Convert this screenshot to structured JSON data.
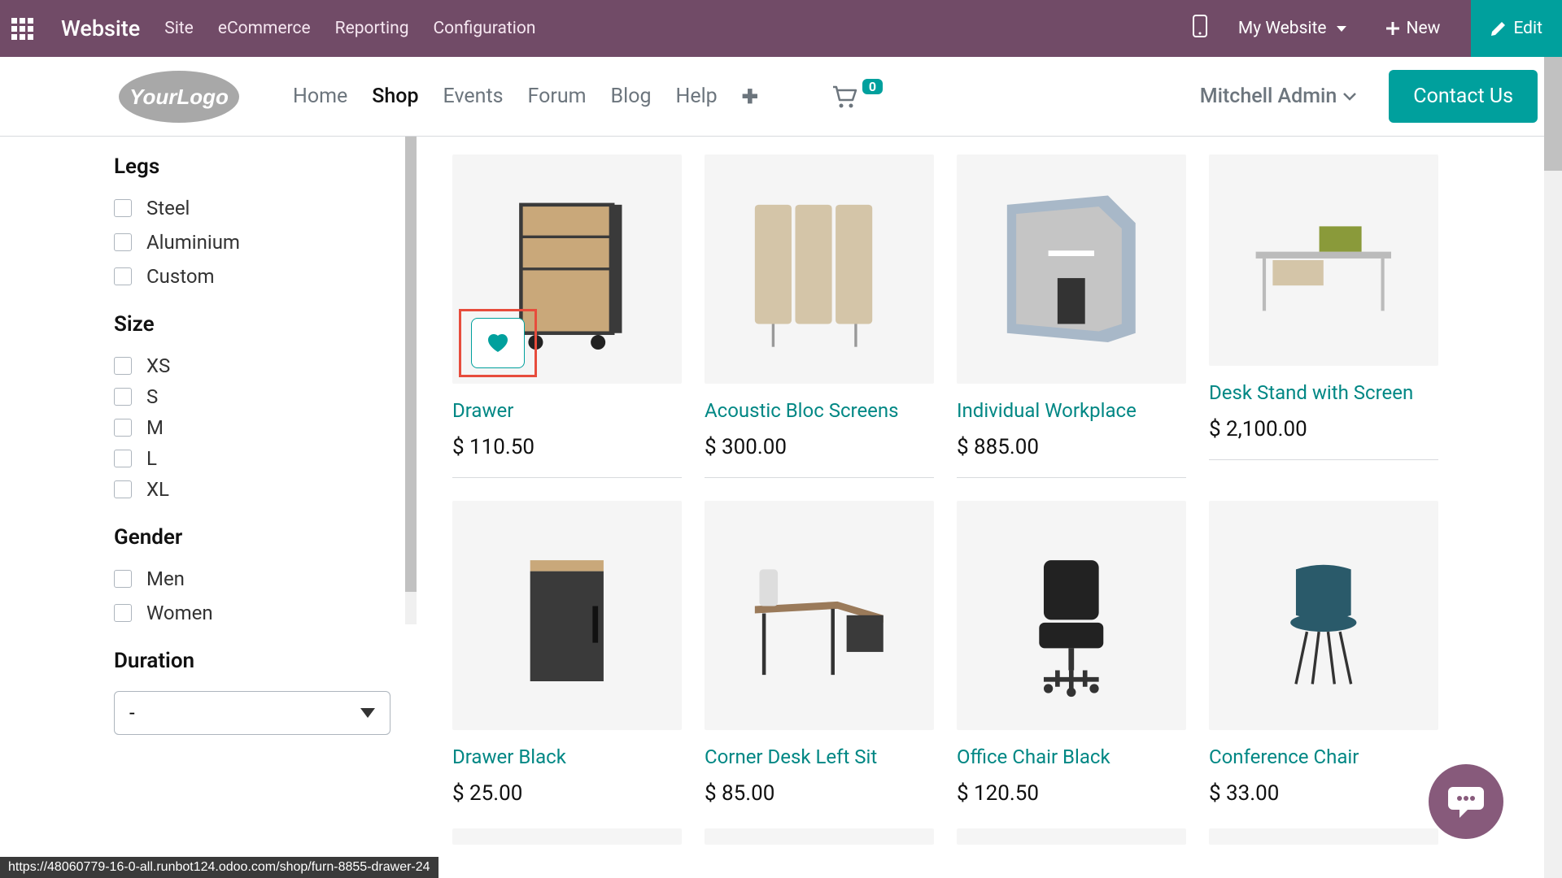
{
  "admin": {
    "brand": "Website",
    "menu": [
      "Site",
      "eCommerce",
      "Reporting",
      "Configuration"
    ],
    "website_selector": "My Website",
    "new_btn": "New",
    "edit_btn": "Edit"
  },
  "header": {
    "nav": [
      "Home",
      "Shop",
      "Events",
      "Forum",
      "Blog",
      "Help"
    ],
    "active_index": 1,
    "cart_count": "0",
    "user": "Mitchell Admin",
    "contact_btn": "Contact Us"
  },
  "filters": {
    "legs": {
      "title": "Legs",
      "options": [
        "Steel",
        "Aluminium",
        "Custom"
      ]
    },
    "size": {
      "title": "Size",
      "options": [
        "XS",
        "S",
        "M",
        "L",
        "XL"
      ]
    },
    "gender": {
      "title": "Gender",
      "options": [
        "Men",
        "Women"
      ]
    },
    "duration": {
      "title": "Duration",
      "value": "-"
    }
  },
  "products": {
    "row1": [
      {
        "name": "Drawer",
        "price": "$ 110.50",
        "highlight_wish": true
      },
      {
        "name": "Acoustic Bloc Screens",
        "price": "$ 300.00"
      },
      {
        "name": "Individual Workplace",
        "price": "$ 885.00"
      },
      {
        "name": "Desk Stand with Screen",
        "price": "$ 2,100.00"
      }
    ],
    "row2": [
      {
        "name": "Drawer Black",
        "price": "$ 25.00"
      },
      {
        "name": "Corner Desk Left Sit",
        "price": "$ 85.00"
      },
      {
        "name": "Office Chair Black",
        "price": "$ 120.50"
      },
      {
        "name": "Conference Chair",
        "price": "$ 33.00"
      }
    ]
  },
  "status_url": "https://48060779-16-0-all.runbot124.odoo.com/shop/furn-8855-drawer-24"
}
